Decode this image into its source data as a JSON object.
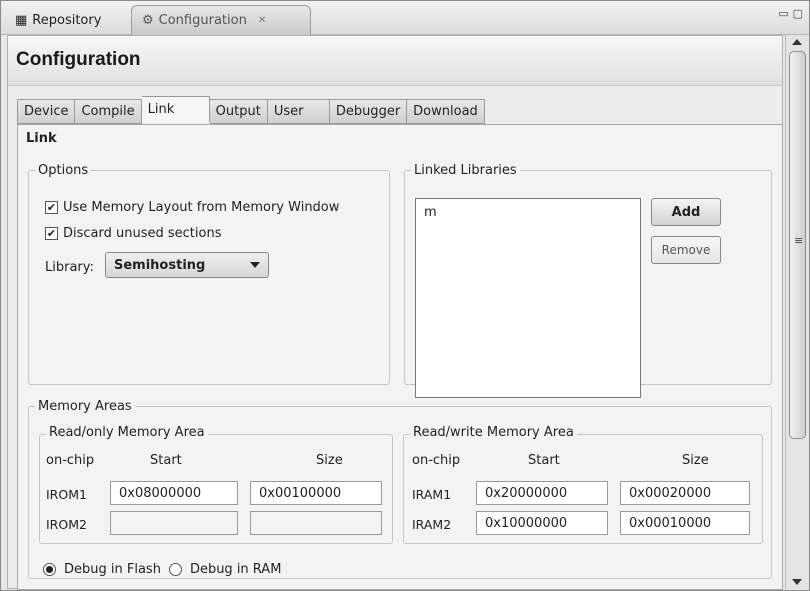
{
  "view_tabs": [
    {
      "label": "Repository",
      "icon": "grid-icon"
    },
    {
      "label": "Configuration",
      "icon": "gear-icon",
      "close": "✕"
    }
  ],
  "window_controls": [
    "▭",
    "▢"
  ],
  "page_title": "Configuration",
  "tabs": [
    "Device",
    "Compile",
    "Link",
    "Output",
    "User",
    "Debugger",
    "Download"
  ],
  "active_tab": "Link",
  "section_title": "Link",
  "options": {
    "legend": "Options",
    "use_memory_layout": {
      "label": "Use Memory Layout from Memory Window",
      "checked": true
    },
    "discard_unused": {
      "label": "Discard unused sections",
      "checked": true
    },
    "library_label": "Library:",
    "library_value": "Semihosting"
  },
  "linked_libraries": {
    "legend": "Linked Libraries",
    "items": [
      "m"
    ],
    "add_label": "Add",
    "remove_label": "Remove"
  },
  "memory_areas": {
    "legend": "Memory Areas",
    "read_only": {
      "legend": "Read/only Memory Area",
      "col_onchip": "on-chip",
      "col_start": "Start",
      "col_size": "Size",
      "rows": [
        {
          "name": "IROM1",
          "start": "0x08000000",
          "size": "0x00100000"
        },
        {
          "name": "IROM2",
          "start": "",
          "size": ""
        }
      ]
    },
    "read_write": {
      "legend": "Read/write Memory Area",
      "col_onchip": "on-chip",
      "col_start": "Start",
      "col_size": "Size",
      "rows": [
        {
          "name": "IRAM1",
          "start": "0x20000000",
          "size": "0x00020000"
        },
        {
          "name": "IRAM2",
          "start": "0x10000000",
          "size": "0x00010000"
        }
      ]
    },
    "debug_flash": {
      "label": "Debug in Flash",
      "selected": true
    },
    "debug_ram": {
      "label": "Debug in RAM",
      "selected": false
    }
  }
}
